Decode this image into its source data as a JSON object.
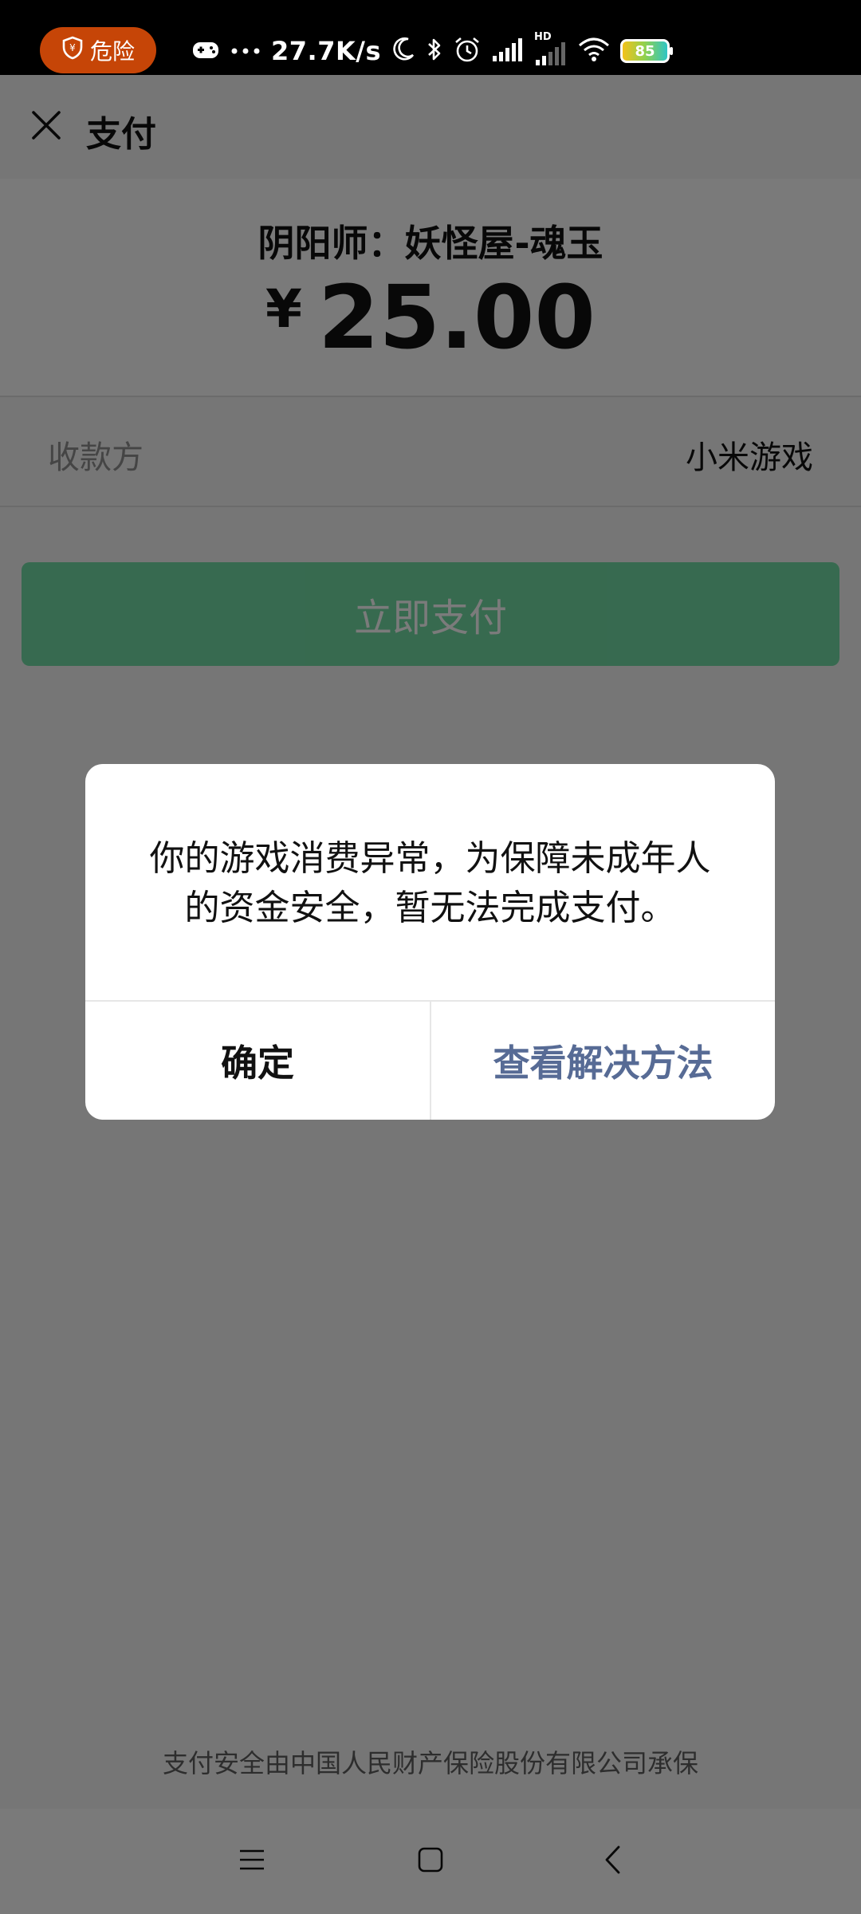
{
  "status_bar": {
    "danger_label": "危险",
    "speed": "27.7K/s",
    "battery": "85",
    "network_badge": "HD"
  },
  "header": {
    "title": "支付"
  },
  "payment": {
    "product": "阴阳师：妖怪屋-魂玉",
    "currency": "¥",
    "amount": "25.00",
    "payee_label": "收款方",
    "payee_value": "小米游戏",
    "pay_button": "立即支付"
  },
  "dialog": {
    "message": "你的游戏消费异常，为保障未成年人的资金安全，暂无法完成支付。",
    "confirm": "确定",
    "solution": "查看解决方法"
  },
  "footer": {
    "insurance_text": "支付安全由中国人民财产保险股份有限公司承保"
  },
  "colors": {
    "danger": "#c64507",
    "pay_green": "#07c160",
    "link_blue": "#576b95"
  }
}
